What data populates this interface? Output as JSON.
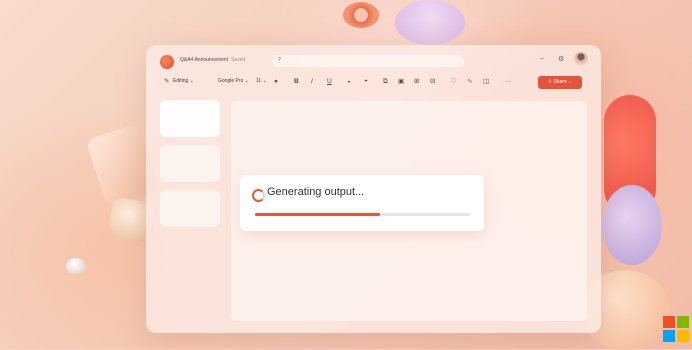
{
  "app": {
    "document_title": "Q&A4 Announcement",
    "document_status": "Saved"
  },
  "toolbar": {
    "editing_label": "Editing",
    "font_name": "Google Pro",
    "font_size": "11",
    "share_label": "Share"
  },
  "generation": {
    "message": "Generating output...",
    "progress": 0.58
  },
  "colors": {
    "accent": "#e5533a",
    "progress": "#e0593b"
  },
  "icons": {
    "pencil": "✎",
    "search": "⌕",
    "minimize": "–",
    "settings": "⚙",
    "chevron": "⌄",
    "more": "···"
  }
}
